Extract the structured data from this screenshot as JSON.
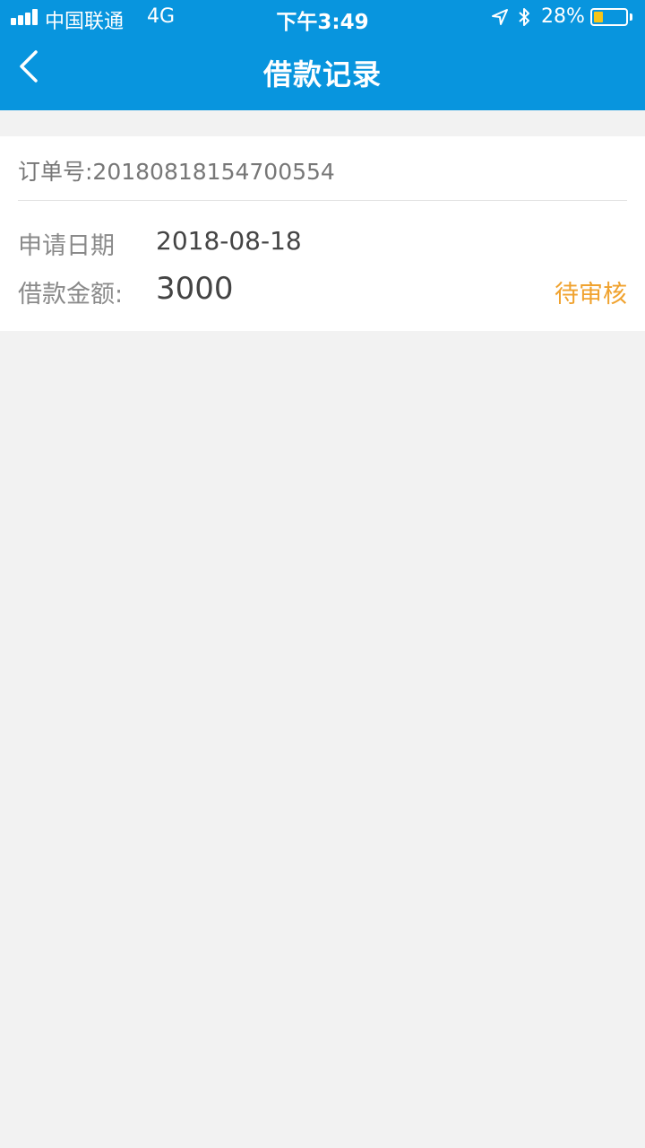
{
  "status_bar": {
    "carrier": "中国联通",
    "network": "4G",
    "time": "下午3:49",
    "battery_percent": "28%",
    "battery_level": 0.28,
    "signal_bars": 4,
    "icons": [
      "signal-icon",
      "location-arrow-icon",
      "bluetooth-icon",
      "battery-icon"
    ]
  },
  "header": {
    "title": "借款记录",
    "back_icon": "chevron-left-icon"
  },
  "record": {
    "order_number": "订单号:20180818154700554",
    "apply_date_label": "申请日期",
    "apply_date": "2018-08-18",
    "amount_label": "借款金额:",
    "amount": "3000",
    "status": "待审核"
  },
  "colors": {
    "header_bg": "#0895de",
    "page_bg": "#f2f2f2",
    "status_pending": "#f0a22e",
    "battery_fill": "#f5c518"
  }
}
